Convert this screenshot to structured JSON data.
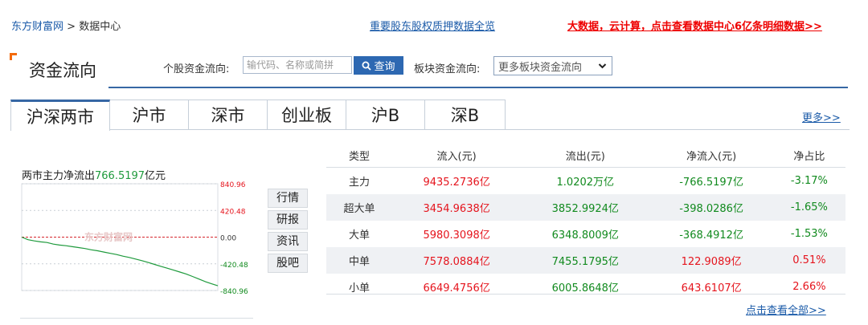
{
  "breadcrumb": {
    "home": "东方财富网",
    "separator": ">",
    "current": "数据中心"
  },
  "header_links": {
    "pledge": "重要股东股权质押数据全览",
    "promo": "大数据，云计算，点击查看数据中心6亿条明细数据>>"
  },
  "page_title": "资金流向",
  "stock_search": {
    "label": "个股资金流向:",
    "placeholder": "输代码、名称或简拼",
    "button_label": "查询"
  },
  "sector": {
    "label": "板块资金流向:",
    "selected": "更多板块资金流向"
  },
  "tabs": [
    "沪深两市",
    "沪市",
    "深市",
    "创业板",
    "沪B",
    "深B"
  ],
  "more_link": "更多>>",
  "chart": {
    "title_prefix": "两市主力净流出",
    "title_value": "766.5197",
    "title_unit": "亿元",
    "watermark": "东方财富网"
  },
  "chart_data": {
    "type": "line",
    "yticks": [
      "840.96",
      "420.48",
      "0.00",
      "-420.48",
      "-840.96"
    ],
    "ylim": [
      -840.96,
      840.96
    ],
    "series": [
      {
        "values": [
          0,
          -40,
          -60,
          -75,
          -85,
          -110,
          -125,
          -135,
          -150,
          -165,
          -180,
          -200,
          -215,
          -235,
          -255,
          -275,
          -300,
          -320,
          -345,
          -370,
          -400,
          -430,
          -460,
          -490,
          -520,
          -550,
          -580,
          -620,
          -660,
          -700,
          -735,
          -766.52
        ]
      }
    ]
  },
  "side_buttons": [
    "行情",
    "研报",
    "资讯",
    "股吧"
  ],
  "table": {
    "headers": [
      "类型",
      "流入(元)",
      "流出(元)",
      "净流入(元)",
      "净占比"
    ],
    "rows": [
      {
        "type": "主力",
        "in": "9435.2736亿",
        "out": "1.0202万亿",
        "net": "-766.5197亿",
        "ratio": "-3.17%"
      },
      {
        "type": "超大单",
        "in": "3454.9638亿",
        "out": "3852.9924亿",
        "net": "-398.0286亿",
        "ratio": "-1.65%"
      },
      {
        "type": "大单",
        "in": "5980.3098亿",
        "out": "6348.8009亿",
        "net": "-368.4912亿",
        "ratio": "-1.53%"
      },
      {
        "type": "中单",
        "in": "7578.0884亿",
        "out": "7455.1795亿",
        "net": "122.9089亿",
        "ratio": "0.51%"
      },
      {
        "type": "小单",
        "in": "6649.4756亿",
        "out": "6005.8648亿",
        "net": "643.6107亿",
        "ratio": "2.66%"
      }
    ]
  },
  "view_all": "点击查看全部>>",
  "colors": {
    "accent": "#3667a4",
    "up": "#e5141d",
    "down": "#118a1e",
    "marker": "#f46a0b"
  }
}
